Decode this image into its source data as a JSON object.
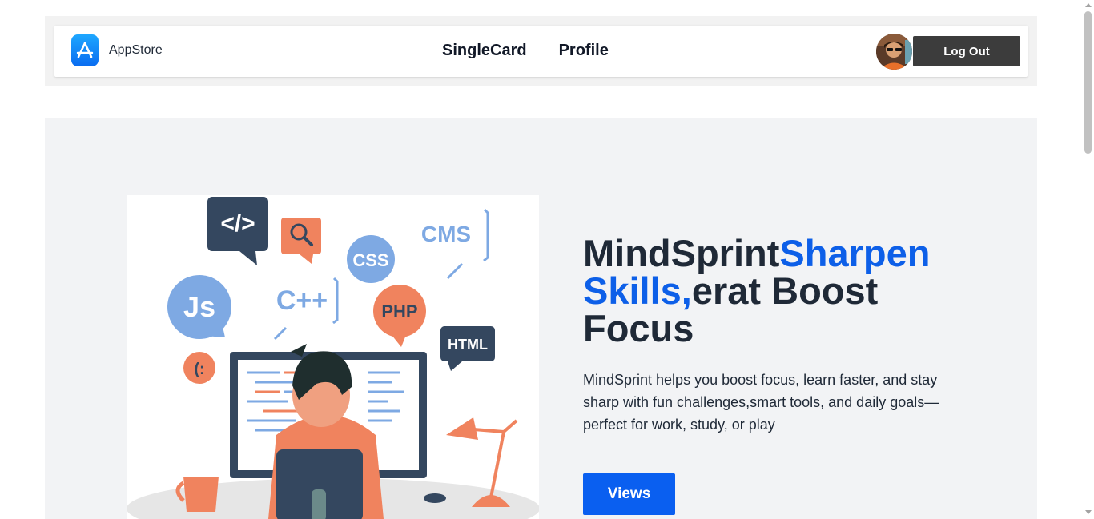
{
  "navbar": {
    "brand_name": "AppStore",
    "links": [
      "SingleCard",
      "Profile"
    ],
    "logout_label": "Log Out",
    "brand_icon": "app-store-icon",
    "avatar_icon": "user-avatar"
  },
  "hero": {
    "title_part1": "MindSprint",
    "title_accent": "Sharpen Skills,",
    "title_part2": "erat Boost Focus",
    "description": "MindSprint helps you boost focus, learn faster, and stay sharp with fun challenges,smart tools, and daily goals—perfect for work, study, or play",
    "button_label": "Views",
    "illustration": {
      "badges": [
        "</>",
        "CSS",
        "CMS",
        "Js",
        "C++",
        "PHP",
        "HTML",
        "(:"
      ]
    }
  },
  "colors": {
    "accent": "#0d5fe8",
    "button_primary": "#0a5ff0",
    "logout_button": "#3c3c3c",
    "hero_bg": "#f2f3f5",
    "header_bg": "#f2f2f2"
  }
}
